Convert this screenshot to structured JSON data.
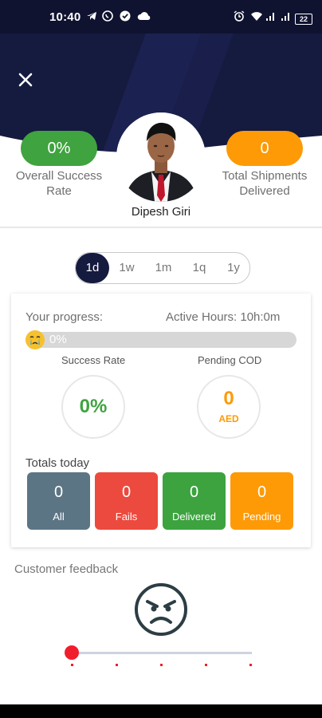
{
  "status_bar": {
    "time": "10:40",
    "icons_left": [
      "telegram-icon",
      "whatsapp-icon",
      "check-circle-icon",
      "cloud-icon"
    ],
    "icons_right": [
      "alarm-icon",
      "wifi-icon",
      "signal-icon",
      "signal-icon",
      "battery-icon"
    ],
    "battery_level": "22"
  },
  "header": {
    "close_icon": "close-icon",
    "success_value": "0%",
    "success_label_line1": "Overall Success",
    "success_label_line2": "Rate",
    "shipments_value": "0",
    "shipments_label_line1": "Total Shipments",
    "shipments_label_line2": "Delivered",
    "user_name": "Dipesh Giri"
  },
  "range_selector": {
    "options": [
      "1d",
      "1w",
      "1m",
      "1q",
      "1y"
    ],
    "selected": "1d"
  },
  "progress_card": {
    "your_progress_label": "Your progress:",
    "active_hours_label": "Active Hours: 10h:0m",
    "progress_percent_text": "0%",
    "progress_value": 0,
    "success_rate_title": "Success Rate",
    "success_rate_value": "0%",
    "pending_cod_title": "Pending COD",
    "pending_cod_value": "0",
    "pending_cod_currency": "AED",
    "totals_label": "Totals today",
    "tiles": [
      {
        "value": "0",
        "label": "All",
        "color": "#5c7584"
      },
      {
        "value": "0",
        "label": "Fails",
        "color": "#ec4a3e"
      },
      {
        "value": "0",
        "label": "Delivered",
        "color": "#3ca33f"
      },
      {
        "value": "0",
        "label": "Pending",
        "color": "#fd9a06"
      }
    ]
  },
  "feedback": {
    "label": "Customer feedback",
    "face_icon": "angry-face-icon",
    "slider_level": 0,
    "slider_steps": 5
  },
  "colors": {
    "navy": "#151a3f",
    "green": "#3fa33f",
    "orange": "#fd9a06",
    "red": "#f01e2c",
    "dark_slate": "#2c3e44"
  }
}
